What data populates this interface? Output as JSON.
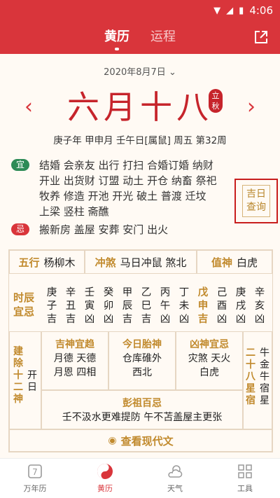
{
  "status": {
    "time": "4:06"
  },
  "header": {
    "tab_active": "黄历",
    "tab_inactive": "运程"
  },
  "date_selector": "2020年8月7日",
  "lunar_date": "六月十八",
  "solar_term": "立秋",
  "ganzhi": "庚子年 甲申月 壬午日[属鼠] 周五 第32周",
  "yi": {
    "label": "宜",
    "lines": [
      "结婚 会亲友 出行 打扫 合婚订婚 纳财",
      "开业 出货财 订盟 动土 开仓 纳畜 祭祀",
      "牧养 修造 开池 开光 破土 普渡 迁坟",
      "上梁 竖柱 斋醮"
    ]
  },
  "ji": {
    "label": "忌",
    "items": "搬新房 盖屋 安葬 安门 出火"
  },
  "jiri": "吉日查询",
  "row1": {
    "wuxing_label": "五行",
    "wuxing": "杨柳木",
    "chongsha_label": "冲煞",
    "chongsha": "马日冲鼠 煞北",
    "zhishen_label": "值神",
    "zhishen": "白虎"
  },
  "shichen": {
    "label": "时辰宜忌",
    "cols": [
      {
        "a": "庚",
        "b": "子",
        "c": "吉"
      },
      {
        "a": "辛",
        "b": "丑",
        "c": "吉"
      },
      {
        "a": "壬",
        "b": "寅",
        "c": "凶"
      },
      {
        "a": "癸",
        "b": "卯",
        "c": "凶"
      },
      {
        "a": "甲",
        "b": "辰",
        "c": "吉"
      },
      {
        "a": "乙",
        "b": "巳",
        "c": "吉"
      },
      {
        "a": "丙",
        "b": "午",
        "c": "凶"
      },
      {
        "a": "丁",
        "b": "未",
        "c": "凶"
      },
      {
        "a": "戊",
        "b": "申",
        "c": "吉"
      },
      {
        "a": "己",
        "b": "酉",
        "c": "凶"
      },
      {
        "a": "庚",
        "b": "戌",
        "c": "凶"
      },
      {
        "a": "辛",
        "b": "亥",
        "c": "凶"
      }
    ]
  },
  "jianchu": {
    "label": "建除十二神",
    "value": "开日"
  },
  "jishen": {
    "label": "吉神宜趋",
    "l1": "月德 天德",
    "l2": "月恩 四相"
  },
  "taishen": {
    "label": "今日胎神",
    "l1": "仓库碓外",
    "l2": "西北"
  },
  "xiongshen": {
    "label": "凶神宜忌",
    "l1": "灾煞 天火",
    "l2": "白虎"
  },
  "xiu": {
    "label": "二十八星宿",
    "value": "牛金牛宿星"
  },
  "pengzu": {
    "label": "彭祖百忌",
    "text": "壬不汲水更难提防 午不苫盖屋主更张"
  },
  "modern": "查看现代文",
  "nav": [
    {
      "label": "万年历"
    },
    {
      "label": "黄历"
    },
    {
      "label": "天气"
    },
    {
      "label": "工具"
    }
  ],
  "calendar_icon_number": "7",
  "colors": {
    "primary": "#d9353b",
    "gold": "#c18a2d"
  }
}
